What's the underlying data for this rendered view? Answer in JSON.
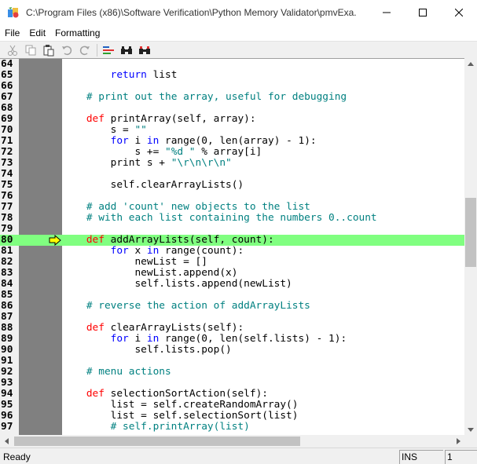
{
  "window": {
    "title": "C:\\Program Files (x86)\\Software Verification\\Python Memory Validator\\pmvExa...",
    "minimize_icon": "minimize-icon",
    "maximize_icon": "maximize-icon",
    "close_icon": "close-icon"
  },
  "menu": {
    "items": [
      "File",
      "Edit",
      "Formatting"
    ]
  },
  "toolbar": {
    "buttons": [
      "cut-icon",
      "copy-icon",
      "paste-icon",
      "undo-icon",
      "redo-icon",
      "format-icon",
      "find-icon",
      "find-next-icon"
    ]
  },
  "editor": {
    "current_line": "80",
    "lines": [
      {
        "num": "64",
        "text": ""
      },
      {
        "num": "65",
        "text": "        return list"
      },
      {
        "num": "66",
        "text": ""
      },
      {
        "num": "67",
        "text": "    # print out the array, useful for debugging"
      },
      {
        "num": "68",
        "text": ""
      },
      {
        "num": "69",
        "text": "    def printArray(self, array):"
      },
      {
        "num": "70",
        "text": "        s = \"\""
      },
      {
        "num": "71",
        "text": "        for i in range(0, len(array) - 1):"
      },
      {
        "num": "72",
        "text": "            s += \"%d \" % array[i]"
      },
      {
        "num": "73",
        "text": "        print s + \"\\r\\n\\r\\n\""
      },
      {
        "num": "74",
        "text": ""
      },
      {
        "num": "75",
        "text": "        self.clearArrayLists()"
      },
      {
        "num": "76",
        "text": ""
      },
      {
        "num": "77",
        "text": "    # add 'count' new objects to the list"
      },
      {
        "num": "78",
        "text": "    # with each list containing the numbers 0..count"
      },
      {
        "num": "79",
        "text": ""
      },
      {
        "num": "80",
        "text": "    def addArrayLists(self, count):"
      },
      {
        "num": "81",
        "text": "        for x in range(count):"
      },
      {
        "num": "82",
        "text": "            newList = []"
      },
      {
        "num": "83",
        "text": "            newList.append(x)"
      },
      {
        "num": "84",
        "text": "            self.lists.append(newList)"
      },
      {
        "num": "85",
        "text": ""
      },
      {
        "num": "86",
        "text": "    # reverse the action of addArrayLists"
      },
      {
        "num": "87",
        "text": ""
      },
      {
        "num": "88",
        "text": "    def clearArrayLists(self):"
      },
      {
        "num": "89",
        "text": "        for i in range(0, len(self.lists) - 1):"
      },
      {
        "num": "90",
        "text": "            self.lists.pop()"
      },
      {
        "num": "91",
        "text": ""
      },
      {
        "num": "92",
        "text": "    # menu actions"
      },
      {
        "num": "93",
        "text": ""
      },
      {
        "num": "94",
        "text": "    def selectionSortAction(self):"
      },
      {
        "num": "95",
        "text": "        list = self.createRandomArray()"
      },
      {
        "num": "96",
        "text": "        list = self.selectionSort(list)"
      },
      {
        "num": "97",
        "text": "        # self.printArray(list)"
      }
    ]
  },
  "status": {
    "text": "Ready",
    "mode": "INS",
    "position": "1"
  },
  "colors": {
    "current_line_bg": "#80ff80",
    "gutter": "#808080",
    "keyword": "#ff0000",
    "builtin_keyword": "#0000ff",
    "comment": "#008080"
  }
}
